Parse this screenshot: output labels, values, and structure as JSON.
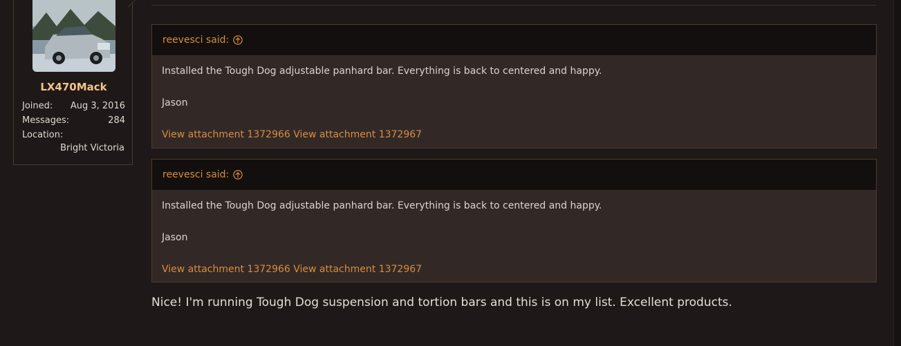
{
  "user": {
    "name": "LX470Mack",
    "joined_label": "Joined:",
    "joined_value": "Aug 3, 2016",
    "messages_label": "Messages:",
    "messages_value": "284",
    "location_label": "Location:",
    "location_value": "Bright Victoria"
  },
  "quotes": [
    {
      "author": "reevesci said:",
      "line1": "Installed the Tough Dog adjustable panhard bar. Everything is back to centered and happy.",
      "line2": "Jason",
      "attach1": "View attachment 1372966",
      "attach2": "View attachment 1372967"
    },
    {
      "author": "reevesci said:",
      "line1": "Installed the Tough Dog adjustable panhard bar. Everything is back to centered and happy.",
      "line2": "Jason",
      "attach1": "View attachment 1372966",
      "attach2": "View attachment 1372967"
    }
  ],
  "reply": "Nice! I'm running Tough Dog suspension and tortion bars and this is on my list. Excellent products.",
  "colors": {
    "background": "#1e1918",
    "accent": "#d98c3f",
    "username": "#f5c489",
    "quote_bg": "#322927",
    "quote_head_bg": "#130f0e",
    "border": "#4d3b2c"
  },
  "icons": {
    "quote_jump": "arrow-up-circle-icon"
  }
}
